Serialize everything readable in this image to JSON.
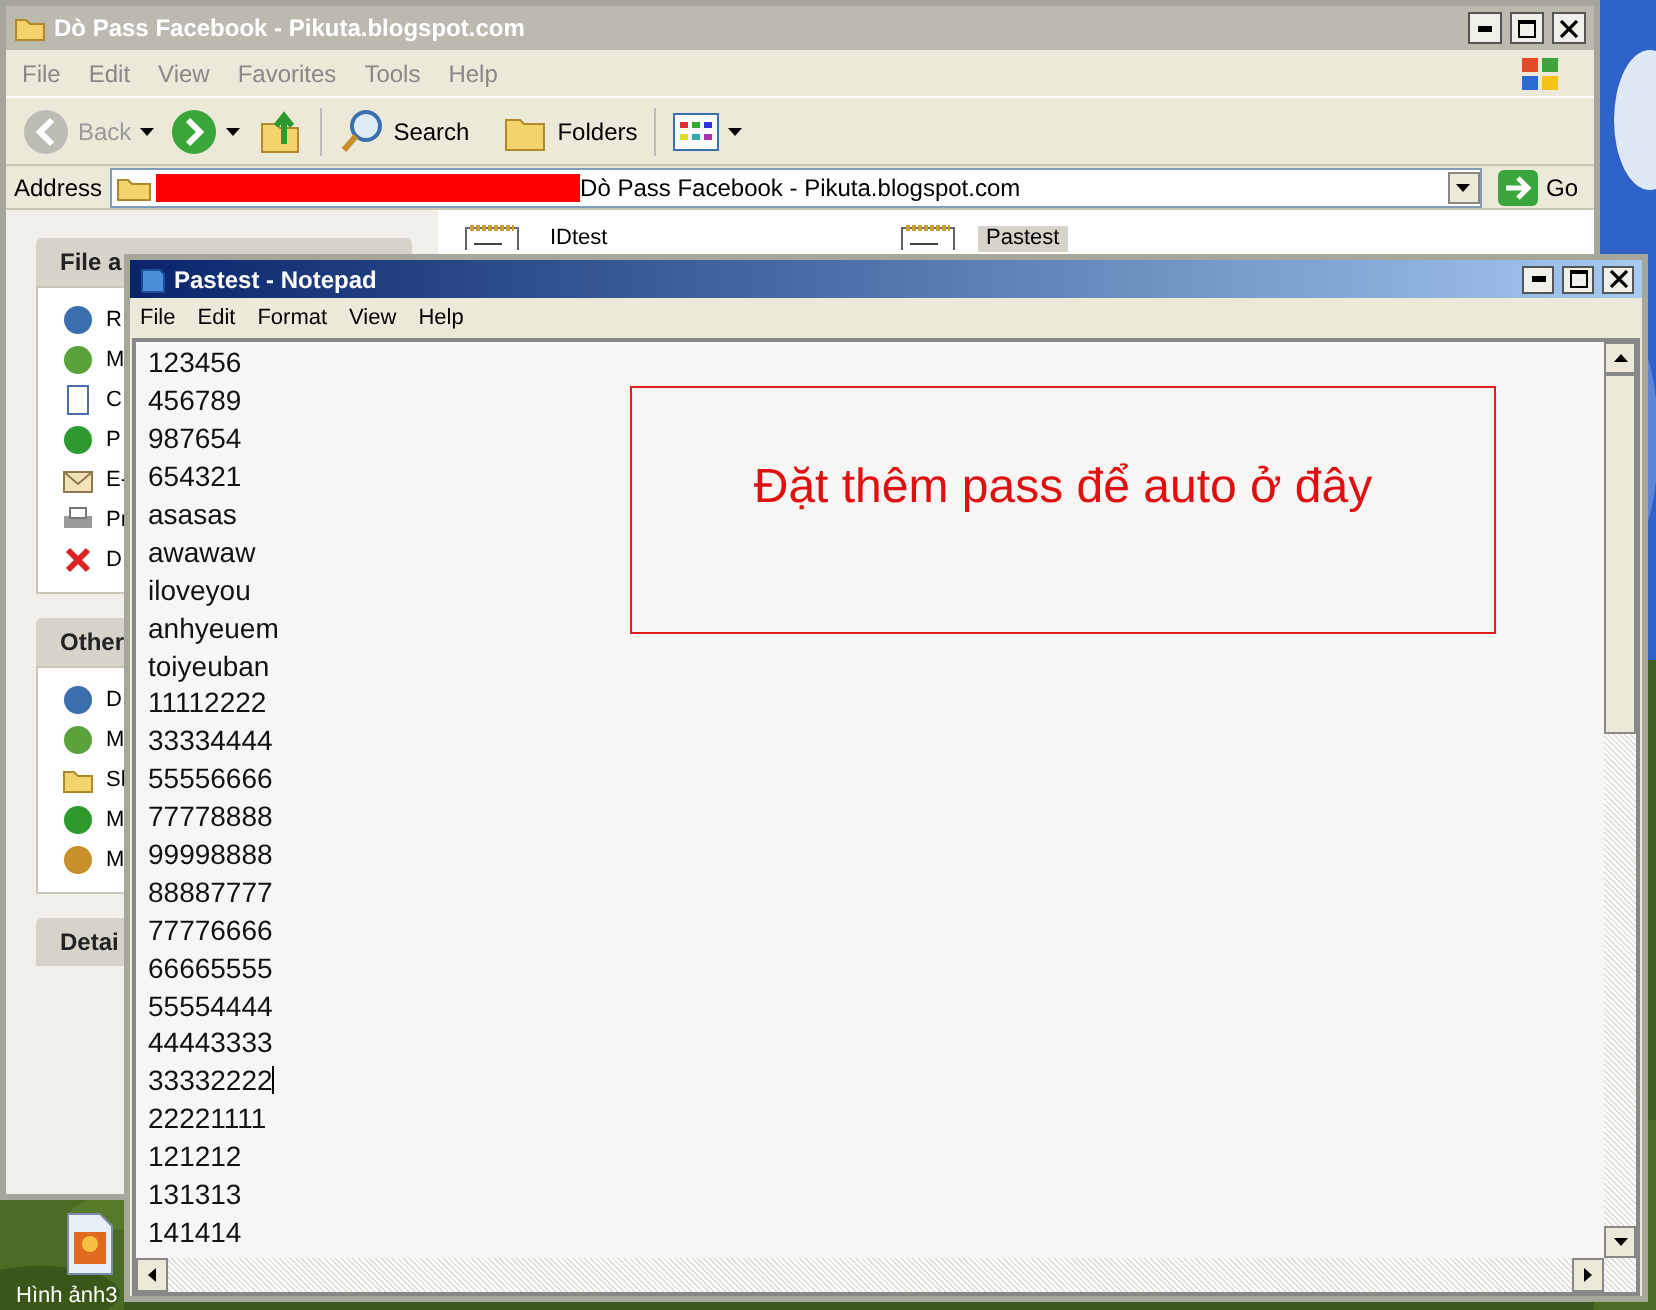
{
  "explorer": {
    "title": "Dò Pass Facebook - Pikuta.blogspot.com",
    "menu": [
      "File",
      "Edit",
      "View",
      "Favorites",
      "Tools",
      "Help"
    ],
    "toolbar": [
      {
        "kind": "back",
        "label": "Back",
        "disabled": true
      },
      {
        "kind": "forward"
      },
      {
        "kind": "up"
      },
      {
        "kind": "search",
        "label": "Search"
      },
      {
        "kind": "folders",
        "label": "Folders"
      },
      {
        "kind": "views"
      }
    ],
    "address": {
      "label": "Address",
      "value": "Dò Pass Facebook - Pikuta.blogspot.com",
      "go": "Go"
    },
    "panels": [
      {
        "title": "File a",
        "items": [
          {
            "kind": "rename",
            "label": "R"
          },
          {
            "kind": "move",
            "label": "M"
          },
          {
            "kind": "copy",
            "label": "C"
          },
          {
            "kind": "publish",
            "label": "P"
          },
          {
            "kind": "email",
            "label": "E-"
          },
          {
            "kind": "print",
            "label": "Pr"
          },
          {
            "kind": "delete",
            "label": "D"
          }
        ]
      },
      {
        "title": "Other",
        "items": [
          {
            "kind": "desktop",
            "label": "D"
          },
          {
            "kind": "docs",
            "label": "M"
          },
          {
            "kind": "folder",
            "label": "Sl"
          },
          {
            "kind": "computer",
            "label": "M"
          },
          {
            "kind": "network",
            "label": "M"
          }
        ]
      },
      {
        "title": "Detai"
      }
    ],
    "files": [
      {
        "name": "IDtest",
        "selected": false
      },
      {
        "name": "Pastest",
        "selected": true
      }
    ]
  },
  "notepad": {
    "title": "Pastest - Notepad",
    "menu": [
      "File",
      "Edit",
      "Format",
      "View",
      "Help"
    ],
    "lines": [
      {
        "text": "123456",
        "caret": false
      },
      {
        "text": "456789",
        "caret": false
      },
      {
        "text": "987654",
        "caret": false
      },
      {
        "text": "654321",
        "caret": false
      },
      {
        "text": "asasas",
        "caret": false
      },
      {
        "text": "awawaw",
        "caret": false
      },
      {
        "text": "iloveyou",
        "caret": false
      },
      {
        "text": "anhyeuem",
        "caret": false
      },
      {
        "text": "toiyeuban",
        "caret": false
      },
      {
        "text": "11112222",
        "caret": false
      },
      {
        "text": "33334444",
        "caret": false
      },
      {
        "text": "55556666",
        "caret": false
      },
      {
        "text": "77778888",
        "caret": false
      },
      {
        "text": "99998888",
        "caret": false
      },
      {
        "text": "88887777",
        "caret": false
      },
      {
        "text": "77776666",
        "caret": false
      },
      {
        "text": "66665555",
        "caret": false
      },
      {
        "text": "55554444",
        "caret": false
      },
      {
        "text": "44443333",
        "caret": false
      },
      {
        "text": "33332222",
        "caret": true
      },
      {
        "text": "22221111",
        "caret": false
      },
      {
        "text": "121212",
        "caret": false
      },
      {
        "text": "131313",
        "caret": false
      },
      {
        "text": "141414",
        "caret": false
      }
    ],
    "note": "Đặt thêm pass để auto ở đây"
  },
  "desktop": {
    "icon_label": "Hình ảnh3"
  }
}
